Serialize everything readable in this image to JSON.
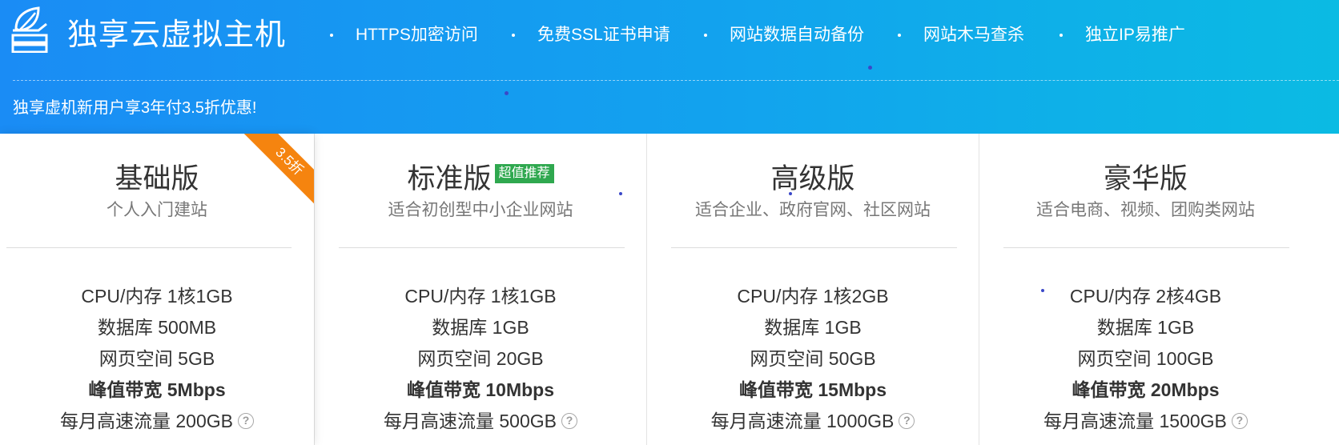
{
  "banner": {
    "brand": "独享云虚拟主机",
    "features": [
      "HTTPS加密访问",
      "免费SSL证书申请",
      "网站数据自动备份",
      "网站木马查杀",
      "独立IP易推广"
    ],
    "promo": "独享虚机新用户享3年付3.5折优惠!"
  },
  "colors": {
    "banner_start": "#1a8cf5",
    "banner_end": "#0bbbe3",
    "ribbon": "#f5840f",
    "badge": "#2fa84f"
  },
  "plans": [
    {
      "name": "基础版",
      "subtitle": "个人入门建站",
      "ribbon": "3.5折",
      "cpu": "CPU/内存 1核1GB",
      "db": "数据库 500MB",
      "space": "网页空间 5GB",
      "bandwidth": "峰值带宽 5Mbps",
      "traffic": "每月高速流量 200GB"
    },
    {
      "name": "标准版",
      "badge": "超值推荐",
      "subtitle": "适合初创型中小企业网站",
      "cpu": "CPU/内存 1核1GB",
      "db": "数据库 1GB",
      "space": "网页空间 20GB",
      "bandwidth": "峰值带宽 10Mbps",
      "traffic": "每月高速流量 500GB"
    },
    {
      "name": "高级版",
      "subtitle": "适合企业、政府官网、社区网站",
      "cpu": "CPU/内存 1核2GB",
      "db": "数据库 1GB",
      "space": "网页空间 50GB",
      "bandwidth": "峰值带宽 15Mbps",
      "traffic": "每月高速流量 1000GB"
    },
    {
      "name": "豪华版",
      "subtitle": "适合电商、视频、团购类网站",
      "cpu": "CPU/内存 2核4GB",
      "db": "数据库 1GB",
      "space": "网页空间 100GB",
      "bandwidth": "峰值带宽 20Mbps",
      "traffic": "每月高速流量 1500GB"
    }
  ],
  "icons": {
    "logo": "hosting-leaf-icon",
    "help": "question-circle-icon"
  }
}
